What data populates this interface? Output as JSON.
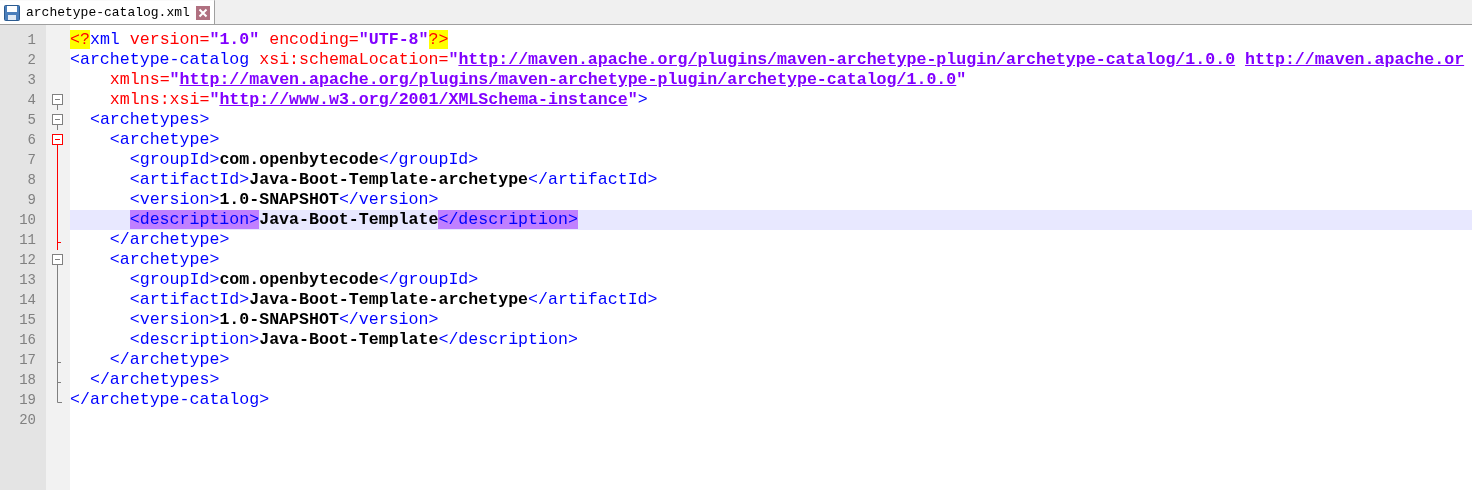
{
  "tab": {
    "title": "archetype-catalog.xml",
    "selected": true
  },
  "lines": [
    {
      "number": "1",
      "current": false,
      "tokens": [
        {
          "kind": "pi",
          "text": "<?"
        },
        {
          "kind": "tag",
          "text": "xml"
        },
        {
          "kind": "attr",
          "text": " version="
        },
        {
          "kind": "value",
          "text": "\"1.0\""
        },
        {
          "kind": "attr",
          "text": " encoding="
        },
        {
          "kind": "value",
          "text": "\"UTF-8\""
        },
        {
          "kind": "pi",
          "text": "?>"
        }
      ]
    },
    {
      "number": "2",
      "current": false,
      "tokens": [
        {
          "kind": "tag",
          "text": "<archetype-catalog"
        },
        {
          "kind": "attr",
          "text": " xsi:schemaLocation="
        },
        {
          "kind": "value",
          "text": "\""
        },
        {
          "kind": "url",
          "text": "http://maven.apache.org/plugins/maven-archetype-plugin/archetype-catalog/1.0.0"
        },
        {
          "kind": "url",
          "text": "http://maven.apache.or"
        }
      ]
    },
    {
      "number": "3",
      "current": false,
      "tokens": [
        {
          "kind": "attr",
          "text": "    xmlns="
        },
        {
          "kind": "value",
          "text": "\""
        },
        {
          "kind": "url",
          "text": "http://maven.apache.org/plugins/maven-archetype-plugin/archetype-catalog/1.0.0"
        },
        {
          "kind": "value",
          "text": "\""
        }
      ]
    },
    {
      "number": "4",
      "fold": {
        "kind": "open",
        "active": false
      },
      "current": false,
      "tokens": [
        {
          "kind": "attr",
          "text": "    xmlns:xsi="
        },
        {
          "kind": "value",
          "text": "\""
        },
        {
          "kind": "url",
          "text": "http://www.w3.org/2001/XMLSchema-instance"
        },
        {
          "kind": "value",
          "text": "\""
        },
        {
          "kind": "tag",
          "text": ">"
        }
      ]
    },
    {
      "number": "5",
      "fold": {
        "kind": "open",
        "active": false
      },
      "current": false,
      "tokens": [
        {
          "kind": "tag",
          "text": "  <archetypes>"
        }
      ]
    },
    {
      "number": "6",
      "fold": {
        "kind": "open",
        "active": true
      },
      "current": false,
      "tokens": [
        {
          "kind": "tag",
          "text": "    <archetype>"
        }
      ]
    },
    {
      "number": "7",
      "fold": {
        "kind": "line",
        "active": true
      },
      "current": false,
      "tokens": [
        {
          "kind": "tag",
          "text": "      <groupId>"
        },
        {
          "kind": "text",
          "text": "com.openbytecode"
        },
        {
          "kind": "tag",
          "text": "</groupId>"
        }
      ]
    },
    {
      "number": "8",
      "fold": {
        "kind": "line",
        "active": true
      },
      "current": false,
      "tokens": [
        {
          "kind": "tag",
          "text": "      <artifactId>"
        },
        {
          "kind": "text",
          "text": "Java-Boot-Template-archetype"
        },
        {
          "kind": "tag",
          "text": "</artifactId>"
        }
      ]
    },
    {
      "number": "9",
      "fold": {
        "kind": "line",
        "active": true
      },
      "current": false,
      "tokens": [
        {
          "kind": "tag",
          "text": "      <version>"
        },
        {
          "kind": "text",
          "text": "1.0-SNAPSHOT"
        },
        {
          "kind": "tag",
          "text": "</version>"
        }
      ]
    },
    {
      "number": "10",
      "fold": {
        "kind": "line",
        "active": true
      },
      "current": true,
      "tokens": [
        {
          "kind": "match",
          "text": "      <description>"
        },
        {
          "kind": "text",
          "text": "Java-Boot-Template"
        },
        {
          "kind": "match",
          "text": "</description>"
        }
      ]
    },
    {
      "number": "11",
      "fold": {
        "kind": "tick",
        "active": true
      },
      "current": false,
      "tokens": [
        {
          "kind": "tag",
          "text": "    </archetype>"
        }
      ]
    },
    {
      "number": "12",
      "fold": {
        "kind": "open",
        "active": false
      },
      "current": false,
      "tokens": [
        {
          "kind": "tag",
          "text": "    <archetype>"
        }
      ]
    },
    {
      "number": "13",
      "fold": {
        "kind": "line",
        "active": false
      },
      "current": false,
      "tokens": [
        {
          "kind": "tag",
          "text": "      <groupId>"
        },
        {
          "kind": "text",
          "text": "com.openbytecode"
        },
        {
          "kind": "tag",
          "text": "</groupId>"
        }
      ]
    },
    {
      "number": "14",
      "fold": {
        "kind": "line",
        "active": false
      },
      "current": false,
      "tokens": [
        {
          "kind": "tag",
          "text": "      <artifactId>"
        },
        {
          "kind": "text",
          "text": "Java-Boot-Template-archetype"
        },
        {
          "kind": "tag",
          "text": "</artifactId>"
        }
      ]
    },
    {
      "number": "15",
      "fold": {
        "kind": "line",
        "active": false
      },
      "current": false,
      "tokens": [
        {
          "kind": "tag",
          "text": "      <version>"
        },
        {
          "kind": "text",
          "text": "1.0-SNAPSHOT"
        },
        {
          "kind": "tag",
          "text": "</version>"
        }
      ]
    },
    {
      "number": "16",
      "fold": {
        "kind": "line",
        "active": false
      },
      "current": false,
      "tokens": [
        {
          "kind": "tag",
          "text": "      <description>"
        },
        {
          "kind": "text",
          "text": "Java-Boot-Template"
        },
        {
          "kind": "tag",
          "text": "</description>"
        }
      ]
    },
    {
      "number": "17",
      "fold": {
        "kind": "tick",
        "active": false
      },
      "current": false,
      "tokens": [
        {
          "kind": "tag",
          "text": "    </archetype>"
        }
      ]
    },
    {
      "number": "18",
      "fold": {
        "kind": "tick",
        "active": false
      },
      "current": false,
      "tokens": [
        {
          "kind": "tag",
          "text": "  </archetypes>"
        }
      ]
    },
    {
      "number": "19",
      "fold": {
        "kind": "end",
        "active": false
      },
      "current": false,
      "tokens": [
        {
          "kind": "tag",
          "text": "</archetype-catalog>"
        }
      ]
    },
    {
      "number": "20",
      "current": false
    }
  ]
}
